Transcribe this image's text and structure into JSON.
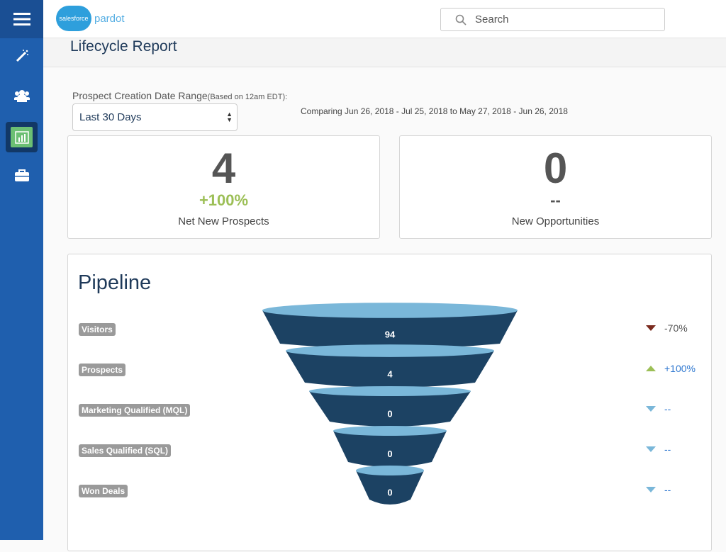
{
  "brand": {
    "cloud": "salesforce",
    "product": "pardot"
  },
  "search": {
    "placeholder": "Search"
  },
  "page": {
    "title": "Lifecycle Report"
  },
  "filter": {
    "label": "Prospect Creation Date Range",
    "label_note": "(Based on 12am EDT):",
    "selected": "Last 30 Days",
    "comparing": "Comparing Jun 26, 2018 - Jul 25, 2018 to May 27, 2018 - Jun 26, 2018"
  },
  "cards": [
    {
      "value": "4",
      "change": "+100%",
      "label": "Net New Prospects"
    },
    {
      "value": "0",
      "change": "--",
      "label": "New Opportunities"
    }
  ],
  "pipeline": {
    "title": "Pipeline",
    "stages": [
      {
        "label": "Visitors",
        "value": "94",
        "change": "-70%",
        "direction": "down",
        "color": "#7a2a1e",
        "text_color": "#555"
      },
      {
        "label": "Prospects",
        "value": "4",
        "change": "+100%",
        "direction": "up",
        "color": "#9cbf56",
        "text_color": "#2f78d0"
      },
      {
        "label": "Marketing Qualified (MQL)",
        "value": "0",
        "change": "--",
        "direction": "down",
        "color": "#7ab7d9",
        "text_color": "#2f78d0"
      },
      {
        "label": "Sales Qualified (SQL)",
        "value": "0",
        "change": "--",
        "direction": "down",
        "color": "#7ab7d9",
        "text_color": "#2f78d0"
      },
      {
        "label": "Won Deals",
        "value": "0",
        "change": "--",
        "direction": "down",
        "color": "#7ab7d9",
        "text_color": "#2f78d0"
      }
    ]
  },
  "colors": {
    "sidebar": "#1f5fae",
    "funnel_dark": "#1c4263",
    "funnel_light": "#7ab7d9",
    "positive": "#9cbf56"
  }
}
